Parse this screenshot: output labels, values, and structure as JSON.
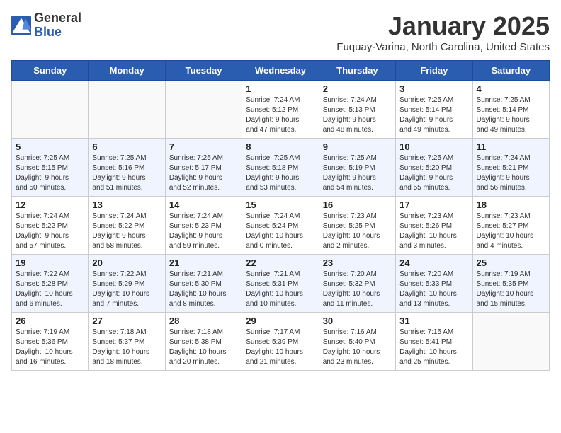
{
  "header": {
    "logo_line1": "General",
    "logo_line2": "Blue",
    "month": "January 2025",
    "location": "Fuquay-Varina, North Carolina, United States"
  },
  "days_of_week": [
    "Sunday",
    "Monday",
    "Tuesday",
    "Wednesday",
    "Thursday",
    "Friday",
    "Saturday"
  ],
  "weeks": [
    [
      {
        "day": "",
        "info": ""
      },
      {
        "day": "",
        "info": ""
      },
      {
        "day": "",
        "info": ""
      },
      {
        "day": "1",
        "info": "Sunrise: 7:24 AM\nSunset: 5:12 PM\nDaylight: 9 hours\nand 47 minutes."
      },
      {
        "day": "2",
        "info": "Sunrise: 7:24 AM\nSunset: 5:13 PM\nDaylight: 9 hours\nand 48 minutes."
      },
      {
        "day": "3",
        "info": "Sunrise: 7:25 AM\nSunset: 5:14 PM\nDaylight: 9 hours\nand 49 minutes."
      },
      {
        "day": "4",
        "info": "Sunrise: 7:25 AM\nSunset: 5:14 PM\nDaylight: 9 hours\nand 49 minutes."
      }
    ],
    [
      {
        "day": "5",
        "info": "Sunrise: 7:25 AM\nSunset: 5:15 PM\nDaylight: 9 hours\nand 50 minutes."
      },
      {
        "day": "6",
        "info": "Sunrise: 7:25 AM\nSunset: 5:16 PM\nDaylight: 9 hours\nand 51 minutes."
      },
      {
        "day": "7",
        "info": "Sunrise: 7:25 AM\nSunset: 5:17 PM\nDaylight: 9 hours\nand 52 minutes."
      },
      {
        "day": "8",
        "info": "Sunrise: 7:25 AM\nSunset: 5:18 PM\nDaylight: 9 hours\nand 53 minutes."
      },
      {
        "day": "9",
        "info": "Sunrise: 7:25 AM\nSunset: 5:19 PM\nDaylight: 9 hours\nand 54 minutes."
      },
      {
        "day": "10",
        "info": "Sunrise: 7:25 AM\nSunset: 5:20 PM\nDaylight: 9 hours\nand 55 minutes."
      },
      {
        "day": "11",
        "info": "Sunrise: 7:24 AM\nSunset: 5:21 PM\nDaylight: 9 hours\nand 56 minutes."
      }
    ],
    [
      {
        "day": "12",
        "info": "Sunrise: 7:24 AM\nSunset: 5:22 PM\nDaylight: 9 hours\nand 57 minutes."
      },
      {
        "day": "13",
        "info": "Sunrise: 7:24 AM\nSunset: 5:22 PM\nDaylight: 9 hours\nand 58 minutes."
      },
      {
        "day": "14",
        "info": "Sunrise: 7:24 AM\nSunset: 5:23 PM\nDaylight: 9 hours\nand 59 minutes."
      },
      {
        "day": "15",
        "info": "Sunrise: 7:24 AM\nSunset: 5:24 PM\nDaylight: 10 hours\nand 0 minutes."
      },
      {
        "day": "16",
        "info": "Sunrise: 7:23 AM\nSunset: 5:25 PM\nDaylight: 10 hours\nand 2 minutes."
      },
      {
        "day": "17",
        "info": "Sunrise: 7:23 AM\nSunset: 5:26 PM\nDaylight: 10 hours\nand 3 minutes."
      },
      {
        "day": "18",
        "info": "Sunrise: 7:23 AM\nSunset: 5:27 PM\nDaylight: 10 hours\nand 4 minutes."
      }
    ],
    [
      {
        "day": "19",
        "info": "Sunrise: 7:22 AM\nSunset: 5:28 PM\nDaylight: 10 hours\nand 6 minutes."
      },
      {
        "day": "20",
        "info": "Sunrise: 7:22 AM\nSunset: 5:29 PM\nDaylight: 10 hours\nand 7 minutes."
      },
      {
        "day": "21",
        "info": "Sunrise: 7:21 AM\nSunset: 5:30 PM\nDaylight: 10 hours\nand 8 minutes."
      },
      {
        "day": "22",
        "info": "Sunrise: 7:21 AM\nSunset: 5:31 PM\nDaylight: 10 hours\nand 10 minutes."
      },
      {
        "day": "23",
        "info": "Sunrise: 7:20 AM\nSunset: 5:32 PM\nDaylight: 10 hours\nand 11 minutes."
      },
      {
        "day": "24",
        "info": "Sunrise: 7:20 AM\nSunset: 5:33 PM\nDaylight: 10 hours\nand 13 minutes."
      },
      {
        "day": "25",
        "info": "Sunrise: 7:19 AM\nSunset: 5:35 PM\nDaylight: 10 hours\nand 15 minutes."
      }
    ],
    [
      {
        "day": "26",
        "info": "Sunrise: 7:19 AM\nSunset: 5:36 PM\nDaylight: 10 hours\nand 16 minutes."
      },
      {
        "day": "27",
        "info": "Sunrise: 7:18 AM\nSunset: 5:37 PM\nDaylight: 10 hours\nand 18 minutes."
      },
      {
        "day": "28",
        "info": "Sunrise: 7:18 AM\nSunset: 5:38 PM\nDaylight: 10 hours\nand 20 minutes."
      },
      {
        "day": "29",
        "info": "Sunrise: 7:17 AM\nSunset: 5:39 PM\nDaylight: 10 hours\nand 21 minutes."
      },
      {
        "day": "30",
        "info": "Sunrise: 7:16 AM\nSunset: 5:40 PM\nDaylight: 10 hours\nand 23 minutes."
      },
      {
        "day": "31",
        "info": "Sunrise: 7:15 AM\nSunset: 5:41 PM\nDaylight: 10 hours\nand 25 minutes."
      },
      {
        "day": "",
        "info": ""
      }
    ]
  ]
}
